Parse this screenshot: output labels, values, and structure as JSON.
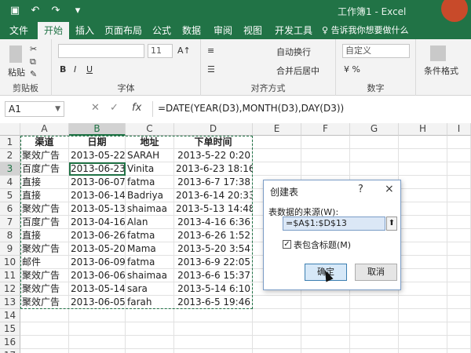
{
  "colors": {
    "accent": "#217346",
    "ribbon_bg": "#f3f3f3",
    "dialog_border": "#7a9cc6",
    "window_btn": "#c84a2a"
  },
  "titlebar": {
    "window_title": "工作簿1 - Excel",
    "icons": [
      "save-icon",
      "undo-icon",
      "redo-icon",
      "qat-dropdown-icon"
    ]
  },
  "ribbon": {
    "tabs": [
      "文件",
      "开始",
      "插入",
      "页面布局",
      "公式",
      "数据",
      "审阅",
      "视图",
      "开发工具"
    ],
    "active_tab": "开始",
    "tell_me": "告诉我你想要做什么",
    "groups": {
      "clipboard": {
        "label": "剪贴板",
        "paste": "粘贴"
      },
      "font": {
        "label": "字体",
        "size": "11"
      },
      "alignment": {
        "label": "对齐方式",
        "wrap": "自动换行",
        "merge": "合并后居中"
      },
      "number": {
        "label": "数字",
        "format": "自定义"
      },
      "styles": {
        "cond": "条件格式"
      }
    }
  },
  "formula_bar": {
    "name_box": "A1",
    "formula": "=DATE(YEAR(D3),MONTH(D3),DAY(D3))"
  },
  "sheet": {
    "columns": [
      "A",
      "B",
      "C",
      "D",
      "E",
      "F",
      "G",
      "H",
      "I"
    ],
    "rows": [
      "1",
      "2",
      "3",
      "4",
      "5",
      "6",
      "7",
      "8",
      "9",
      "10",
      "11",
      "12",
      "13",
      "14",
      "15",
      "16",
      "17"
    ],
    "headers": [
      "渠道",
      "日期",
      "地址",
      "下单时间"
    ],
    "data": [
      [
        "聚效广告",
        "2013-05-22",
        "SARAH",
        "2013-5-22 0:20"
      ],
      [
        "百度广告",
        "2013-06-23",
        "Vinita",
        "2013-6-23 18:16"
      ],
      [
        "直接",
        "2013-06-07",
        "fatma",
        "2013-6-7 17:38"
      ],
      [
        "直接",
        "2013-06-14",
        "Badriya",
        "2013-6-14 20:33"
      ],
      [
        "聚效广告",
        "2013-05-13",
        "shaimaa",
        "2013-5-13 14:48"
      ],
      [
        "百度广告",
        "2013-04-16",
        "Alan",
        "2013-4-16 6:36"
      ],
      [
        "直接",
        "2013-06-26",
        "fatma",
        "2013-6-26 1:52"
      ],
      [
        "聚效广告",
        "2013-05-20",
        "Mama",
        "2013-5-20 3:54"
      ],
      [
        "邮件",
        "2013-06-09",
        "fatma",
        "2013-6-9 22:05"
      ],
      [
        "聚效广告",
        "2013-06-06",
        "shaimaa",
        "2013-6-6 15:37"
      ],
      [
        "聚效广告",
        "2013-05-14",
        "sara",
        "2013-5-14 6:10"
      ],
      [
        "聚效广告",
        "2013-06-05",
        "farah",
        "2013-6-5 19:46"
      ]
    ]
  },
  "dialog": {
    "title": "创建表",
    "help": "?",
    "close": "×",
    "source_label": "表数据的来源(W):",
    "range": "=$A$1:$D$13",
    "checkbox_label": "表包含标题(M)",
    "checkbox_checked": true,
    "ok": "确定",
    "cancel": "取消"
  }
}
